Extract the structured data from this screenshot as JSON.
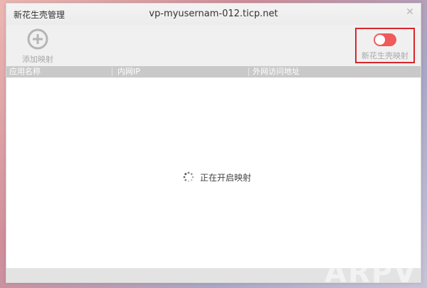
{
  "window": {
    "app_title": "新花生壳管理",
    "host": "vp-myusernam-012.ticp.net"
  },
  "toolbar": {
    "add_label": "添加映射",
    "add_icon": "plus-circle-icon",
    "toggle_label": "新花生壳映射",
    "toggle_state": "off",
    "toggle_color": "#f05a5a"
  },
  "table": {
    "columns": [
      "应用名称",
      "内网IP",
      "外网访问地址"
    ]
  },
  "status": {
    "loading_text": "正在开启映射"
  },
  "watermark": {
    "text": "ARPVI"
  }
}
